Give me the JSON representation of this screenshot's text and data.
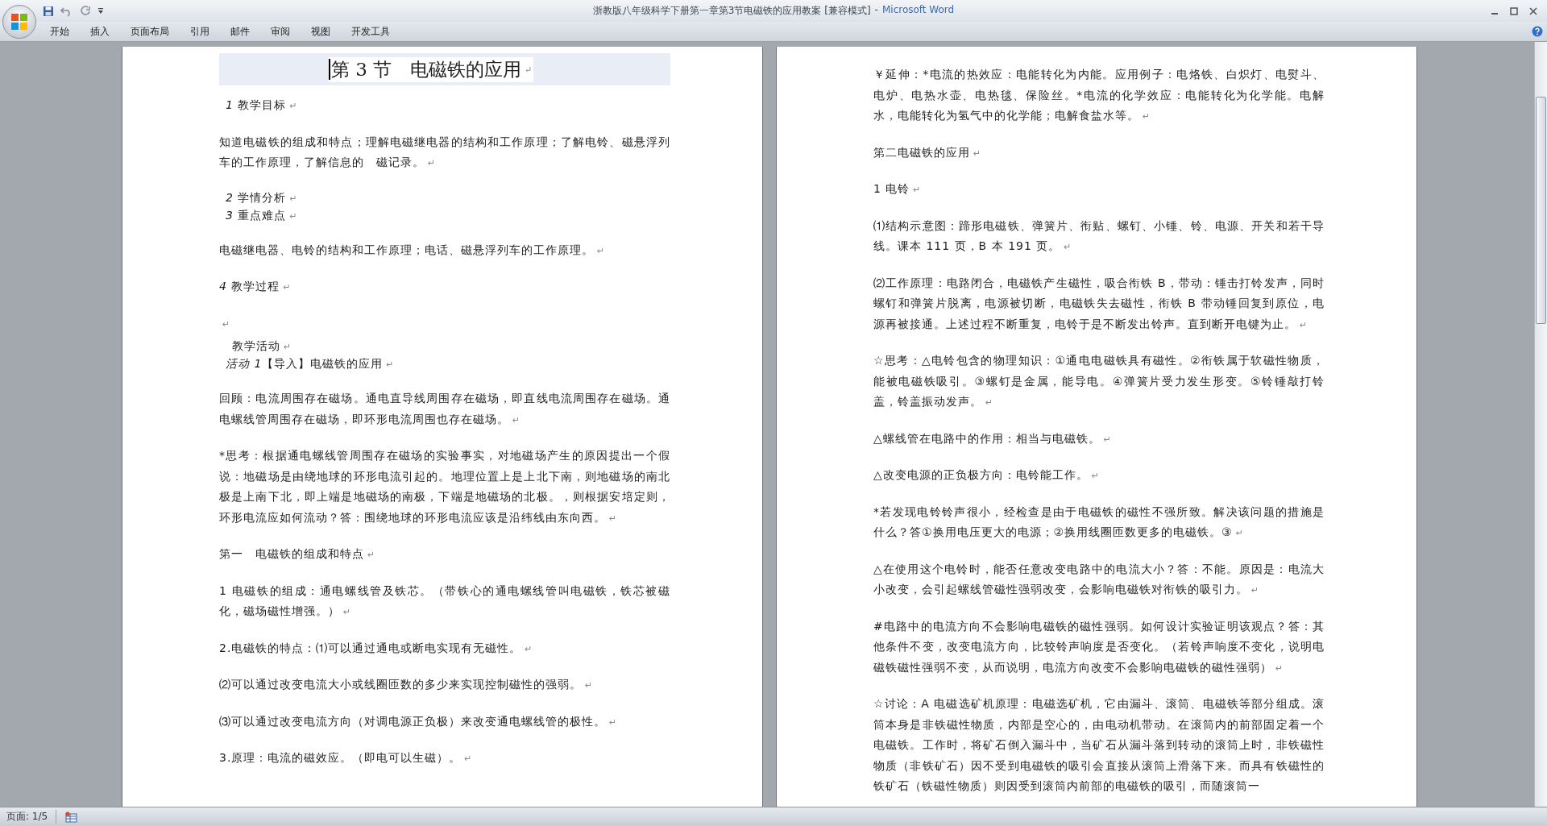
{
  "window": {
    "doc_title": "浙教版八年级科学下册第一章第3节电磁铁的应用教案 [兼容模式]",
    "separator": "-",
    "app_name": "Microsoft Word"
  },
  "ribbon_tabs": [
    {
      "label": "开始",
      "selected": false
    },
    {
      "label": "插入",
      "selected": false
    },
    {
      "label": "页面布局",
      "selected": false
    },
    {
      "label": "引用",
      "selected": false
    },
    {
      "label": "邮件",
      "selected": false
    },
    {
      "label": "审阅",
      "selected": false
    },
    {
      "label": "视图",
      "selected": false
    },
    {
      "label": "开发工具",
      "selected": false
    }
  ],
  "pages": [
    {
      "paragraphs": [
        {
          "kind": "title",
          "text": "第 3 节　电磁铁的应用",
          "mark": "↵"
        },
        {
          "kind": "heading",
          "text": "*1* 教学目标",
          "mark": "↵"
        },
        {
          "kind": "body",
          "text": "知道电磁铁的组成和特点；理解电磁继电器的结构和工作原理；了解电铃、磁悬浮列车的工作原理，了解信息的　磁记录。",
          "mark": "↵"
        },
        {
          "kind": "group",
          "lines": [
            {
              "kind": "heading",
              "text": "*2* 学情分析",
              "mark": "↵"
            },
            {
              "kind": "heading",
              "text": "*3* 重点难点",
              "mark": "↵"
            }
          ]
        },
        {
          "kind": "body",
          "text": "电磁继电器、电铃的结构和工作原理；电话、磁悬浮列车的工作原理。",
          "mark": "↵"
        },
        {
          "kind": "heading-flush",
          "text": "*4* 教学过程",
          "mark": "↵"
        },
        {
          "kind": "blank",
          "mark": "↵"
        },
        {
          "kind": "group",
          "lines": [
            {
              "kind": "subheading",
              "text": "教学活动",
              "mark": "↵"
            },
            {
              "kind": "heading",
              "text": "*活动 1*【导入】电磁铁的应用",
              "mark": "↵"
            }
          ]
        },
        {
          "kind": "body",
          "text": "回顾：电流周围存在磁场。通电直导线周围存在磁场，即直线电流周围存在磁场。通电螺线管周围存在磁场，即环形电流周围也存在磁场。",
          "mark": "↵"
        },
        {
          "kind": "body",
          "text": "*思考：根据通电螺线管周围存在磁场的实验事实，对地磁场产生的原因提出一个假说：地磁场是由绕地球的环形电流引起的。地理位置上是上北下南，则地磁场的南北极是上南下北，即上端是地磁场的南极，下端是地磁场的北极。，则根据安培定则，环形电流应如何流动？答：围绕地球的环形电流应该是沿纬线由东向西。",
          "mark": "↵"
        },
        {
          "kind": "body",
          "text": "第一　电磁铁的组成和特点",
          "mark": "↵"
        },
        {
          "kind": "body",
          "text": "1 电磁铁的组成：通电螺线管及铁芯。（带铁心的通电螺线管叫电磁铁，铁芯被磁化，磁场磁性增强。）",
          "mark": "↵"
        },
        {
          "kind": "body",
          "text": "2.电磁铁的特点：⑴可以通过通电或断电实现有无磁性。",
          "mark": "↵"
        },
        {
          "kind": "body",
          "text": "⑵可以通过改变电流大小或线圈匝数的多少来实现控制磁性的强弱。",
          "mark": "↵"
        },
        {
          "kind": "body",
          "text": "⑶可以通过改变电流方向（对调电源正负极）来改变通电螺线管的极性。",
          "mark": "↵"
        },
        {
          "kind": "body",
          "text": "3.原理：电流的磁效应。（即电可以生磁）。",
          "mark": "↵"
        }
      ]
    },
    {
      "paragraphs": [
        {
          "kind": "body",
          "text": "￥延伸：*电流的热效应：电能转化为内能。应用例子：电烙铁、白炽灯、电熨斗、电炉、电热水壶、电热毯、保险丝。*电流的化学效应：电能转化为化学能。电解水，电能转化为氢气中的化学能；电解食盐水等。",
          "mark": "↵"
        },
        {
          "kind": "body",
          "text": "第二电磁铁的应用",
          "mark": "↵"
        },
        {
          "kind": "body",
          "text": "1 电铃",
          "mark": "↵"
        },
        {
          "kind": "body",
          "text": "⑴结构示意图：蹄形电磁铁、弹簧片、衔贴、螺钉、小锤、铃、电源、开关和若干导线。课本 111 页，B 本 191 页。",
          "mark": "↵"
        },
        {
          "kind": "body",
          "text": "⑵工作原理：电路闭合，电磁铁产生磁性，吸合衔铁 B，带动：锤击打铃发声，同时螺钉和弹簧片脱离，电源被切断，电磁铁失去磁性，衔铁 B 带动锤回复到原位，电源再被接通。上述过程不断重复，电铃于是不断发出铃声。直到断开电键为止。",
          "mark": "↵"
        },
        {
          "kind": "body",
          "text": "☆思考：△电铃包含的物理知识：①通电电磁铁具有磁性。②衔铁属于软磁性物质，能被电磁铁吸引。③螺钉是金属，能导电。④弹簧片受力发生形变。⑤铃锤敲打铃盖，铃盖振动发声。",
          "mark": "↵"
        },
        {
          "kind": "body",
          "text": "△螺线管在电路中的作用：相当与电磁铁。",
          "mark": "↵"
        },
        {
          "kind": "body",
          "text": "△改变电源的正负极方向：电铃能工作。",
          "mark": "↵"
        },
        {
          "kind": "body",
          "text": "*若发现电铃铃声很小，经检查是由于电磁铁的磁性不强所致。解决该问题的措施是什么？答①换用电压更大的电源；②换用线圈匝数更多的电磁铁。③",
          "mark": "↵"
        },
        {
          "kind": "body",
          "text": "△在使用这个电铃时，能否任意改变电路中的电流大小？答：不能。原因是：电流大小改变，会引起螺线管磁性强弱改变，会影响电磁铁对衔铁的吸引力。",
          "mark": "↵"
        },
        {
          "kind": "body",
          "text": "#电路中的电流方向不会影响电磁铁的磁性强弱。如何设计实验证明该观点？答：其他条件不变，改变电流方向，比较铃声响度是否变化。（若铃声响度不变化，说明电磁铁磁性强弱不变，从而说明，电流方向改变不会影响电磁铁的磁性强弱）",
          "mark": "↵"
        },
        {
          "kind": "body",
          "text": "☆讨论：A 电磁选矿机原理：电磁选矿机，它由漏斗、滚筒、电磁铁等部分组成。滚筒本身是非铁磁性物质，内部是空心的，由电动机带动。在滚筒内的前部固定着一个电磁铁。工作时，将矿石倒入漏斗中，当矿石从漏斗落到转动的滚筒上时，非铁磁性物质（非铁矿石）因不受到电磁铁的吸引会直接从滚筒上滑落下来。而具有铁磁性的铁矿石（铁磁性物质）则因受到滚筒内前部的电磁铁的吸引，而随滚筒一"
        }
      ]
    }
  ],
  "status_bar": {
    "page": "页面: 1/5"
  }
}
